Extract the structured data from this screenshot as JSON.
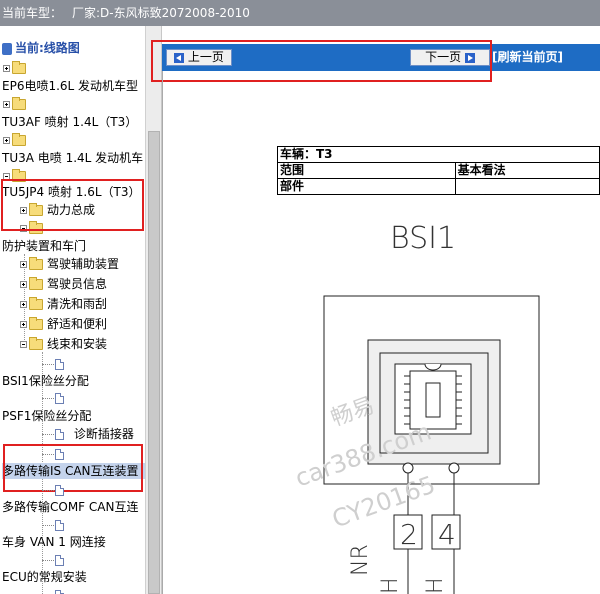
{
  "header": {
    "label": "当前车型：",
    "value": "厂家:D-东风标致2072008-2010"
  },
  "tree": {
    "root": "当前:线路图",
    "items": [
      {
        "label": "EP6电喷1.6L 发动机车型"
      },
      {
        "label": "TU3AF 喷射 1.4L（T3）"
      },
      {
        "label": "TU3A 电喷 1.4L 发动机车"
      },
      {
        "label": "TU5JP4 喷射 1.6L（T3）"
      },
      {
        "label": "动力总成"
      },
      {
        "label": "防护装置和车门"
      },
      {
        "label": "驾驶辅助装置"
      },
      {
        "label": "驾驶员信息"
      },
      {
        "label": "清洗和雨刮"
      },
      {
        "label": "舒适和便利"
      },
      {
        "label": "线束和安装"
      },
      {
        "label": "BSI1保险丝分配"
      },
      {
        "label": "PSF1保险丝分配"
      },
      {
        "label": "诊断插接器"
      },
      {
        "label": "多路传输IS CAN互连装置"
      },
      {
        "label": "多路传输COMF CAN互连"
      },
      {
        "label": "车身 VAN 1 网连接"
      },
      {
        "label": "ECU的常规安装"
      }
    ]
  },
  "nav": {
    "prev": "上一页",
    "next": "下一页",
    "refresh": "[刷新当前页]"
  },
  "info_table": {
    "row1": "车辆：T3",
    "row2_label": "范围",
    "row2_value": "基本看法",
    "row3_label": "部件"
  },
  "diagram": {
    "title": "BSI1",
    "pin_left": "2",
    "pin_right": "4",
    "side_label": "NR",
    "wire_label_left": "H",
    "wire_label_right": "H"
  },
  "watermark": {
    "line1": "畅易",
    "line2": "car388.com",
    "line3": "CY20165"
  }
}
